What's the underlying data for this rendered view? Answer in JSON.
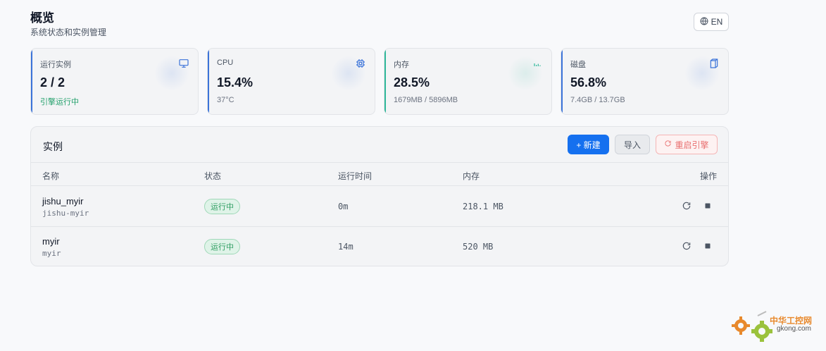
{
  "header": {
    "title": "概览",
    "subtitle": "系统状态和实例管理",
    "lang_label": "EN",
    "lang_icon": "globe-icon"
  },
  "stats": [
    {
      "label": "运行实例",
      "value": "2 / 2",
      "sub": "引擎运行中",
      "icon": "monitor-icon",
      "accent": "#3b73d9",
      "sub_color": "#22a06b"
    },
    {
      "label": "CPU",
      "value": "15.4%",
      "sub": "37°C",
      "icon": "cpu-icon",
      "accent": "#3b73d9"
    },
    {
      "label": "内存",
      "value": "28.5%",
      "sub": "1679MB / 5896MB",
      "icon": "bars-icon",
      "accent": "#2fb89a"
    },
    {
      "label": "磁盘",
      "value": "56.8%",
      "sub": "7.4GB / 13.7GB",
      "icon": "cylinder-icon",
      "accent": "#3b73d9"
    }
  ],
  "instances_panel": {
    "title": "实例",
    "new_button": "+ 新建",
    "import_button": "导入",
    "restart_button": "重启引擎",
    "columns": {
      "name": "名称",
      "status": "状态",
      "uptime": "运行时间",
      "memory": "内存",
      "actions": "操作"
    },
    "rows": [
      {
        "name": "jishu_myir",
        "id": "jishu-myir",
        "status": "运行中",
        "uptime": "0m",
        "memory": "218.1 MB"
      },
      {
        "name": "myir",
        "id": "myir",
        "status": "运行中",
        "uptime": "14m",
        "memory": "520 MB"
      }
    ]
  },
  "watermark": {
    "text": "中华工控网",
    "url": "gkong.com"
  },
  "colors": {
    "primary": "#1570ef",
    "success": "#22a06b",
    "danger": "#e97171"
  }
}
